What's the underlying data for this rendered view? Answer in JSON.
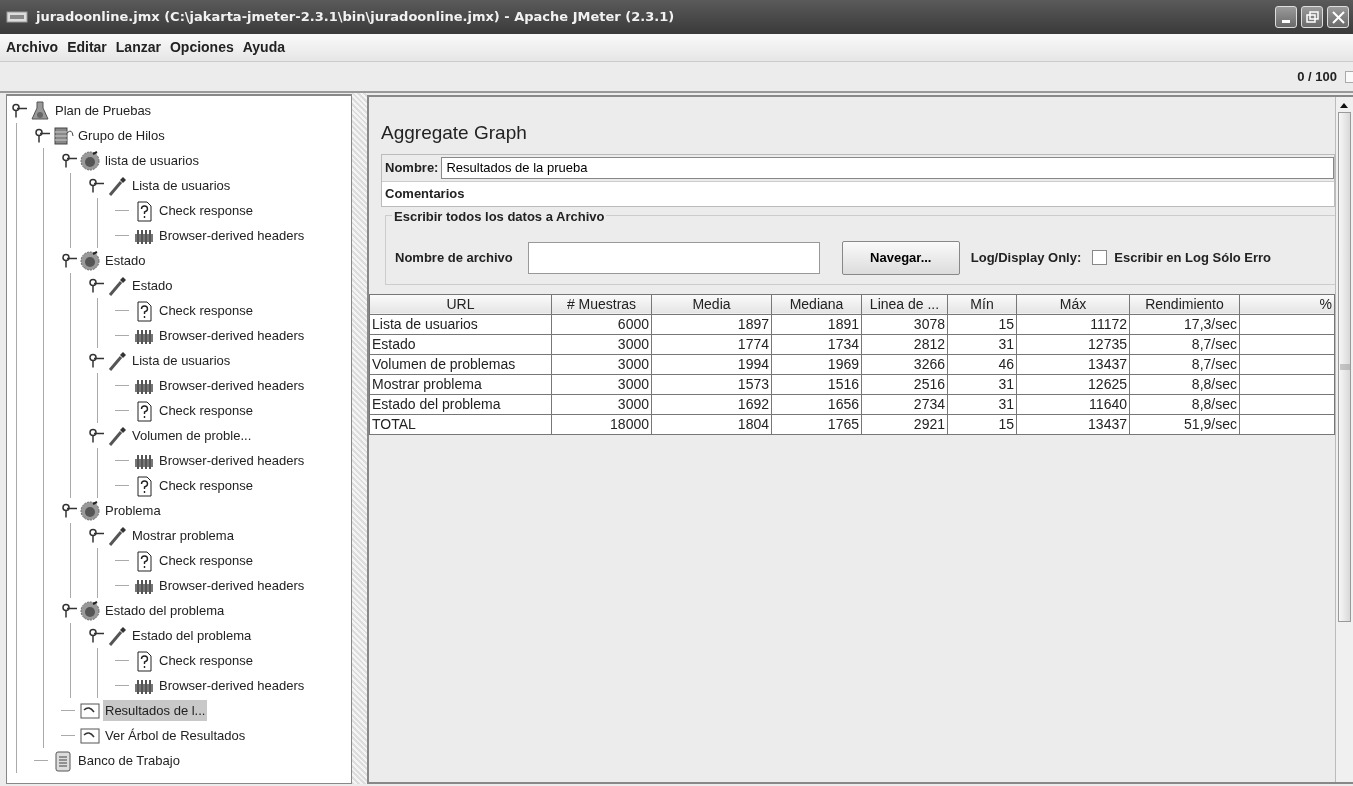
{
  "window": {
    "title": "juradoonline.jmx (C:\\jakarta-jmeter-2.3.1\\bin\\juradoonline.jmx) - Apache JMeter (2.3.1)"
  },
  "menu": [
    "Archivo",
    "Editar",
    "Lanzar",
    "Opciones",
    "Ayuda"
  ],
  "toolbar": {
    "counter": "0 / 100"
  },
  "tree": [
    {
      "label": "Plan de Pruebas",
      "kind": "plan",
      "selected": false,
      "children": [
        {
          "label": "Grupo de Hilos",
          "kind": "threadgroup",
          "selected": false,
          "children": [
            {
              "label": "lista de usuarios",
              "kind": "controller",
              "selected": false,
              "children": [
                {
                  "label": "Lista de usuarios",
                  "kind": "sampler",
                  "selected": false,
                  "children": [
                    {
                      "label": "Check response",
                      "kind": "assertion",
                      "selected": false
                    },
                    {
                      "label": "Browser-derived headers",
                      "kind": "headers",
                      "selected": false
                    }
                  ]
                }
              ]
            },
            {
              "label": "Estado",
              "kind": "controller",
              "selected": false,
              "children": [
                {
                  "label": "Estado",
                  "kind": "sampler",
                  "selected": false,
                  "children": [
                    {
                      "label": "Check response",
                      "kind": "assertion",
                      "selected": false
                    },
                    {
                      "label": "Browser-derived headers",
                      "kind": "headers",
                      "selected": false
                    }
                  ]
                },
                {
                  "label": "Lista de usuarios",
                  "kind": "sampler",
                  "selected": false,
                  "children": [
                    {
                      "label": "Browser-derived headers",
                      "kind": "headers",
                      "selected": false
                    },
                    {
                      "label": "Check response",
                      "kind": "assertion",
                      "selected": false
                    }
                  ]
                },
                {
                  "label": "Volumen de proble...",
                  "kind": "sampler",
                  "selected": false,
                  "children": [
                    {
                      "label": "Browser-derived headers",
                      "kind": "headers",
                      "selected": false
                    },
                    {
                      "label": "Check response",
                      "kind": "assertion",
                      "selected": false
                    }
                  ]
                }
              ]
            },
            {
              "label": "Problema",
              "kind": "controller",
              "selected": false,
              "children": [
                {
                  "label": "Mostrar problema",
                  "kind": "sampler",
                  "selected": false,
                  "children": [
                    {
                      "label": "Check response",
                      "kind": "assertion",
                      "selected": false
                    },
                    {
                      "label": "Browser-derived headers",
                      "kind": "headers",
                      "selected": false
                    }
                  ]
                }
              ]
            },
            {
              "label": "Estado del problema",
              "kind": "controller",
              "selected": false,
              "children": [
                {
                  "label": "Estado del problema",
                  "kind": "sampler",
                  "selected": false,
                  "children": [
                    {
                      "label": "Check response",
                      "kind": "assertion",
                      "selected": false
                    },
                    {
                      "label": "Browser-derived headers",
                      "kind": "headers",
                      "selected": false
                    }
                  ]
                }
              ]
            },
            {
              "label": "Resultados de l...",
              "kind": "listener",
              "selected": true
            },
            {
              "label": "Ver Árbol de Resultados",
              "kind": "listener",
              "selected": false
            }
          ]
        },
        {
          "label": "Banco de Trabajo",
          "kind": "workbench",
          "selected": false
        }
      ]
    }
  ],
  "panel": {
    "title": "Aggregate Graph",
    "name_label": "Nombre:",
    "name_value": "Resultados de la prueba",
    "comments_label": "Comentarios",
    "file_group": {
      "legend": "Escribir todos los datos a Archivo",
      "file_label": "Nombre de archivo",
      "browse_button": "Navegar...",
      "log_label": "Log/Display Only:",
      "errors_checkbox": {
        "label": "Escribir en Log Sólo Erro",
        "checked": false
      }
    }
  },
  "table": {
    "columns": [
      "URL",
      "# Muestras",
      "Media",
      "Mediana",
      "Linea de ...",
      "Mín",
      "Máx",
      "Rendimiento",
      "%"
    ],
    "rows": [
      [
        "Lista de usuarios",
        "6000",
        "1897",
        "1891",
        "3078",
        "15",
        "11172",
        "17,3/sec"
      ],
      [
        "Estado",
        "3000",
        "1774",
        "1734",
        "2812",
        "31",
        "12735",
        "8,7/sec"
      ],
      [
        "Volumen de problemas",
        "3000",
        "1994",
        "1969",
        "3266",
        "46",
        "13437",
        "8,7/sec"
      ],
      [
        "Mostrar problema",
        "3000",
        "1573",
        "1516",
        "2516",
        "31",
        "12625",
        "8,8/sec"
      ],
      [
        "Estado del problema",
        "3000",
        "1692",
        "1656",
        "2734",
        "31",
        "11640",
        "8,8/sec"
      ],
      [
        "TOTAL",
        "18000",
        "1804",
        "1765",
        "2921",
        "15",
        "13437",
        "51,9/sec"
      ]
    ]
  }
}
